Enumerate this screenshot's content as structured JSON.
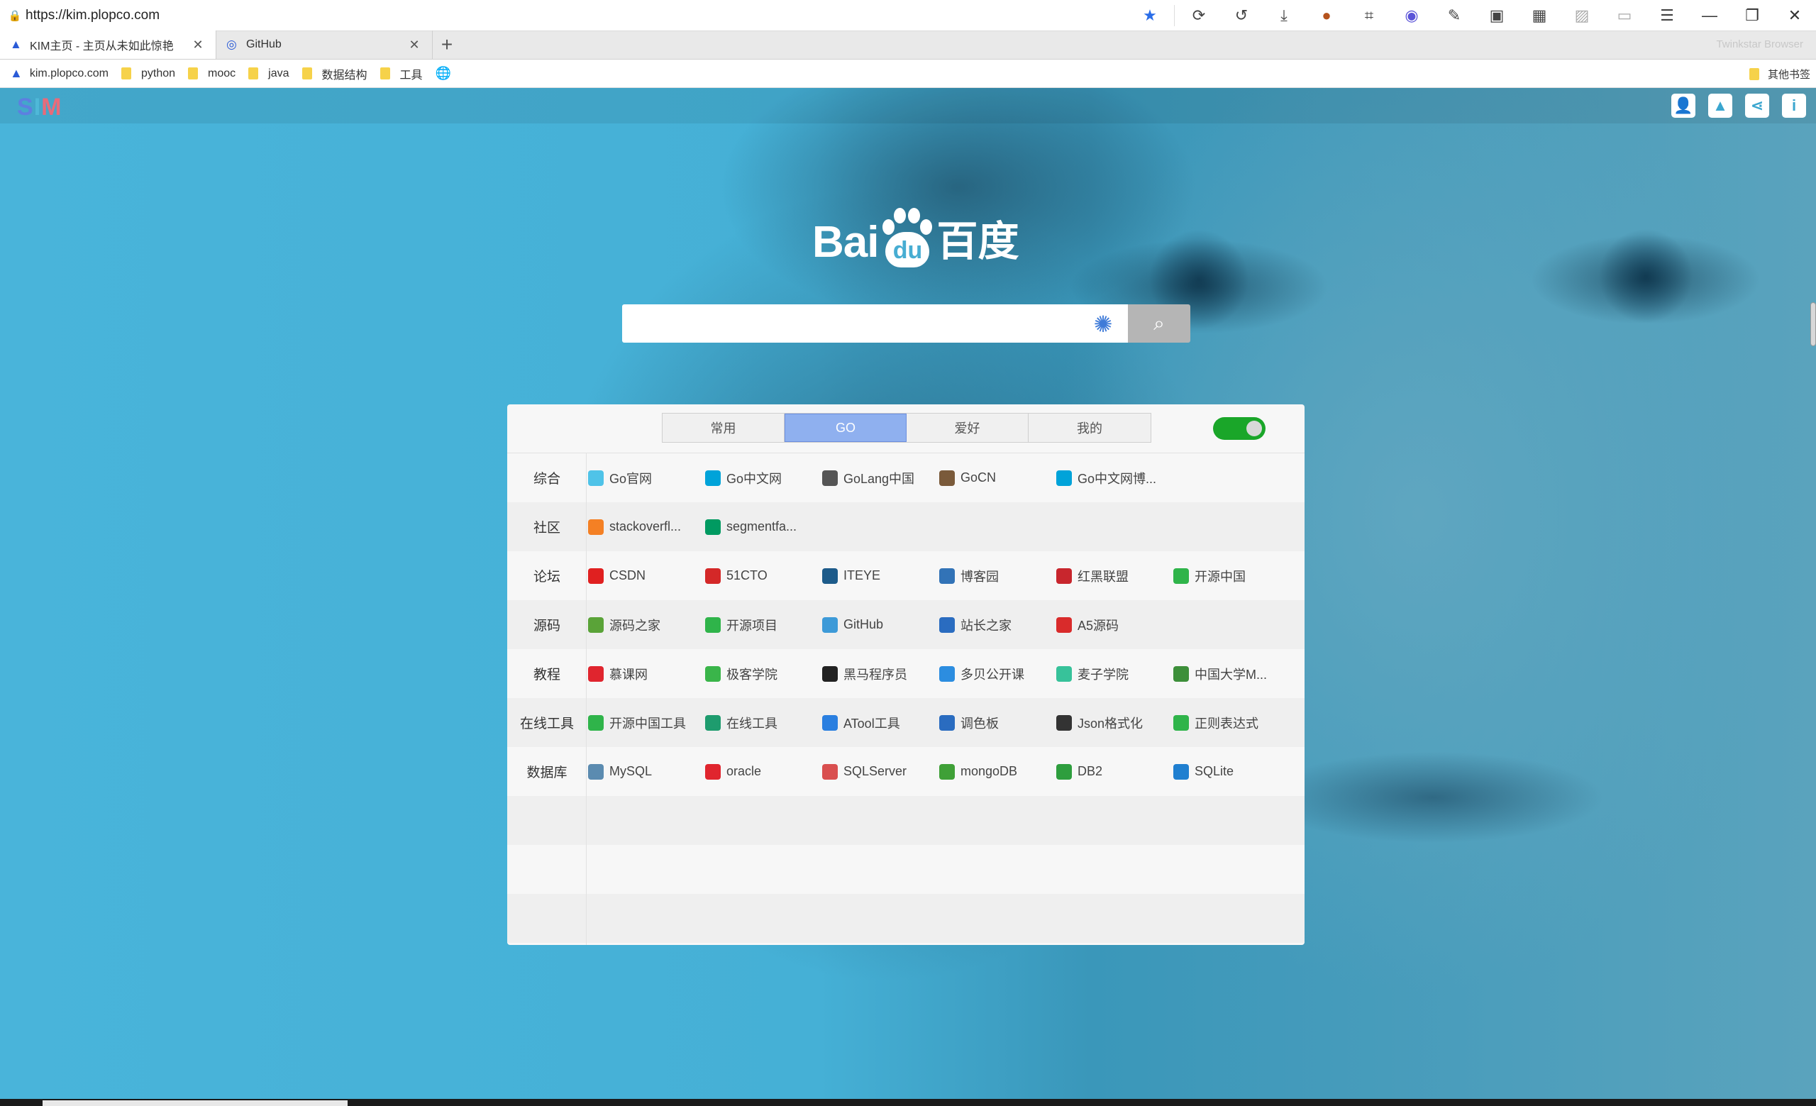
{
  "browser": {
    "url": "https://kim.plopco.com",
    "brand": "Twinkstar Browser",
    "tabs": [
      {
        "title": "KIM主页 - 主页从未如此惊艳",
        "active": true
      },
      {
        "title": "GitHub",
        "active": false
      }
    ],
    "bookmarks": [
      "kim.plopco.com",
      "python",
      "mooc",
      "java",
      "数据结构",
      "工具"
    ],
    "other_bookmarks": "其他书签"
  },
  "site": {
    "logo": {
      "s": "S",
      "i": "I",
      "m": "M"
    },
    "baidu": {
      "bai": "Bai",
      "du_paw": "du",
      "du": "百度"
    },
    "search": {
      "placeholder": ""
    }
  },
  "nav": {
    "tabs": [
      "常用",
      "GO",
      "爱好",
      "我的"
    ],
    "active_tab": "GO",
    "toggle_on": true,
    "rows": [
      {
        "category": "综合",
        "links": [
          {
            "label": "Go官网",
            "icon": "go-gopher-icon",
            "color": "#4fc3e8"
          },
          {
            "label": "Go中文网",
            "icon": "go-text-icon",
            "color": "#00a3d9"
          },
          {
            "label": "GoLang中国",
            "icon": "golang-china-icon",
            "color": "#555555"
          },
          {
            "label": "GoCN",
            "icon": "gocn-icon",
            "color": "#7a5a3a"
          },
          {
            "label": "Go中文网博...",
            "icon": "go-text-icon",
            "color": "#00a3d9"
          }
        ]
      },
      {
        "category": "社区",
        "links": [
          {
            "label": "stackoverfl...",
            "icon": "stackoverflow-icon",
            "color": "#f48024"
          },
          {
            "label": "segmentfa...",
            "icon": "segmentfault-icon",
            "color": "#009a61"
          }
        ]
      },
      {
        "category": "论坛",
        "links": [
          {
            "label": "CSDN",
            "icon": "csdn-icon",
            "color": "#e02020"
          },
          {
            "label": "51CTO",
            "icon": "51cto-icon",
            "color": "#d42828"
          },
          {
            "label": "ITEYE",
            "icon": "iteye-icon",
            "color": "#1d5b8a"
          },
          {
            "label": "博客园",
            "icon": "cnblogs-icon",
            "color": "#3273b7"
          },
          {
            "label": "红黑联盟",
            "icon": "2cto-icon",
            "color": "#c8262d"
          },
          {
            "label": "开源中国",
            "icon": "oschina-icon",
            "color": "#2fb44a"
          }
        ]
      },
      {
        "category": "源码",
        "links": [
          {
            "label": "源码之家",
            "icon": "mycodes-icon",
            "color": "#5aa338"
          },
          {
            "label": "开源项目",
            "icon": "oschina-icon",
            "color": "#2fb44a"
          },
          {
            "label": "GitHub",
            "icon": "github-icon",
            "color": "#3d9ad8"
          },
          {
            "label": "站长之家",
            "icon": "chinaz-icon",
            "color": "#2a6cc0"
          },
          {
            "label": "A5源码",
            "icon": "a5-icon",
            "color": "#d92b2b"
          }
        ]
      },
      {
        "category": "教程",
        "links": [
          {
            "label": "慕课网",
            "icon": "imooc-icon",
            "color": "#e0252e"
          },
          {
            "label": "极客学院",
            "icon": "jikexueyuan-icon",
            "color": "#3ab54a"
          },
          {
            "label": "黑马程序员",
            "icon": "itheima-icon",
            "color": "#222222"
          },
          {
            "label": "多贝公开课",
            "icon": "duobei-icon",
            "color": "#2c8de0"
          },
          {
            "label": "麦子学院",
            "icon": "maiziedu-icon",
            "color": "#37c29a"
          },
          {
            "label": "中国大学M...",
            "icon": "icourse163-icon",
            "color": "#3d8f3a"
          }
        ]
      },
      {
        "category": "在线工具",
        "links": [
          {
            "label": "开源中国工具",
            "icon": "oschina-icon",
            "color": "#2fb44a"
          },
          {
            "label": "在线工具",
            "icon": "tool-lu-icon",
            "color": "#1e9c6e"
          },
          {
            "label": "ATool工具",
            "icon": "atool-icon",
            "color": "#2a7fe0"
          },
          {
            "label": "调色板",
            "icon": "palette-icon",
            "color": "#2a6cc0"
          },
          {
            "label": "Json格式化",
            "icon": "json-icon",
            "color": "#333333"
          },
          {
            "label": "正则表达式",
            "icon": "oschina-icon",
            "color": "#2fb44a"
          }
        ]
      },
      {
        "category": "数据库",
        "links": [
          {
            "label": "MySQL",
            "icon": "mysql-icon",
            "color": "#5b8bb0"
          },
          {
            "label": "oracle",
            "icon": "oracle-icon",
            "color": "#e0252e"
          },
          {
            "label": "SQLServer",
            "icon": "sqlserver-icon",
            "color": "#d94f4f"
          },
          {
            "label": "mongoDB",
            "icon": "mongodb-icon",
            "color": "#3fa037"
          },
          {
            "label": "DB2",
            "icon": "db2-icon",
            "color": "#2e9e3e"
          },
          {
            "label": "SQLite",
            "icon": "sqlite-icon",
            "color": "#1f7fd0"
          }
        ]
      }
    ]
  },
  "colors": {
    "accent": "#8fb0ef",
    "toggle": "#1aa629",
    "bg": "#45b0d6"
  }
}
